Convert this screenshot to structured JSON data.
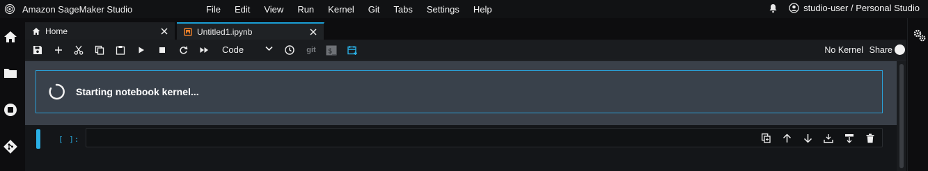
{
  "app": {
    "title": "Amazon SageMaker Studio"
  },
  "menu": [
    "File",
    "Edit",
    "View",
    "Run",
    "Kernel",
    "Git",
    "Tabs",
    "Settings",
    "Help"
  ],
  "user": {
    "label": "studio-user / Personal Studio"
  },
  "tabs": [
    {
      "label": "Home",
      "icon": "home-icon"
    },
    {
      "label": "Untitled1.ipynb",
      "icon": "notebook-icon"
    }
  ],
  "toolbar": {
    "cell_type": "Code",
    "git_label": "git",
    "kernel_label": "No Kernel",
    "share_label": "Share"
  },
  "notebook": {
    "status_message": "Starting notebook kernel...",
    "cell_prompt": "[ ]:"
  },
  "colors": {
    "accent": "#2ab0e6",
    "notebook_icon": "#f0812a",
    "banner_bg": "#3a4049"
  }
}
